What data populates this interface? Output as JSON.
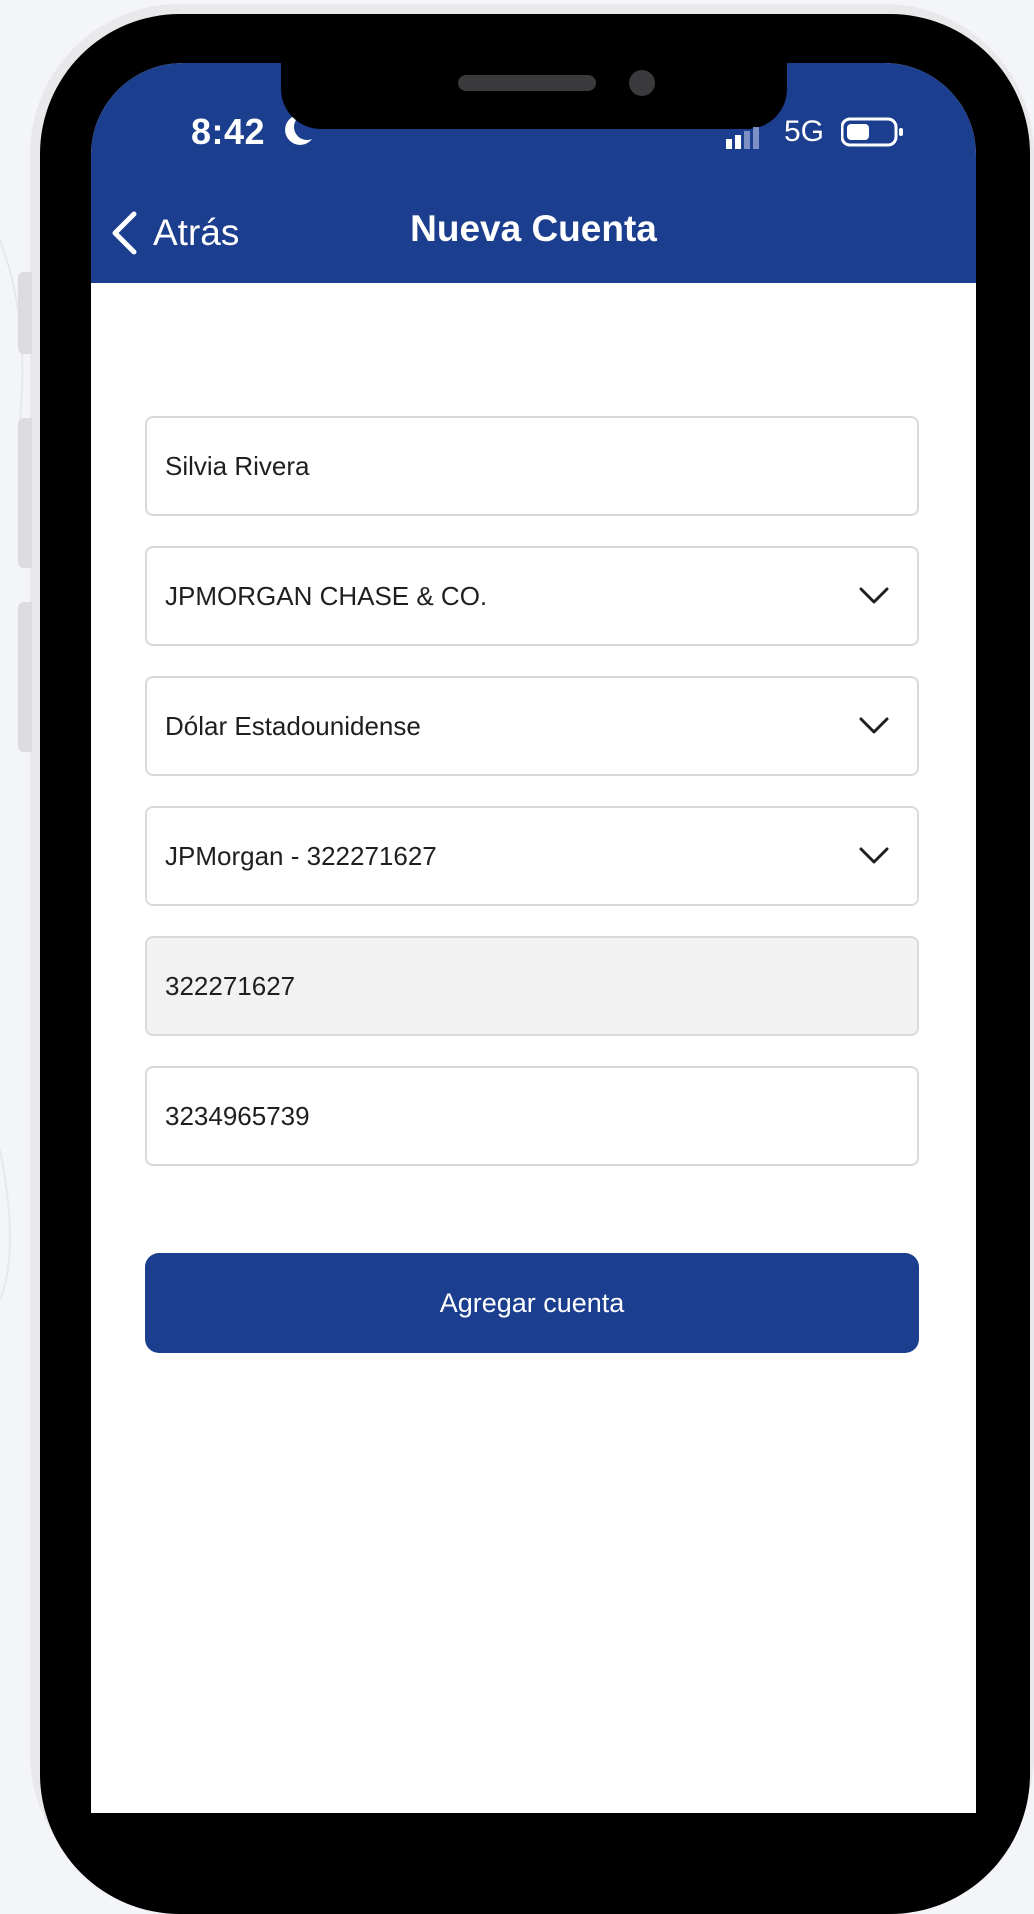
{
  "status_bar": {
    "time": "8:42",
    "network": "5G"
  },
  "header": {
    "back_label": "Atrás",
    "title": "Nueva Cuenta"
  },
  "form": {
    "name": "Silvia Rivera",
    "bank": "JPMORGAN CHASE & CO.",
    "currency": "Dólar Estadounidense",
    "account_type": "JPMorgan - 322271627",
    "routing_number": "322271627",
    "account_number": "3234965739"
  },
  "actions": {
    "submit_label": "Agregar cuenta"
  },
  "colors": {
    "brand": "#1c3e8f",
    "field_border": "#d9dade",
    "disabled_field": "#f2f2f3"
  }
}
